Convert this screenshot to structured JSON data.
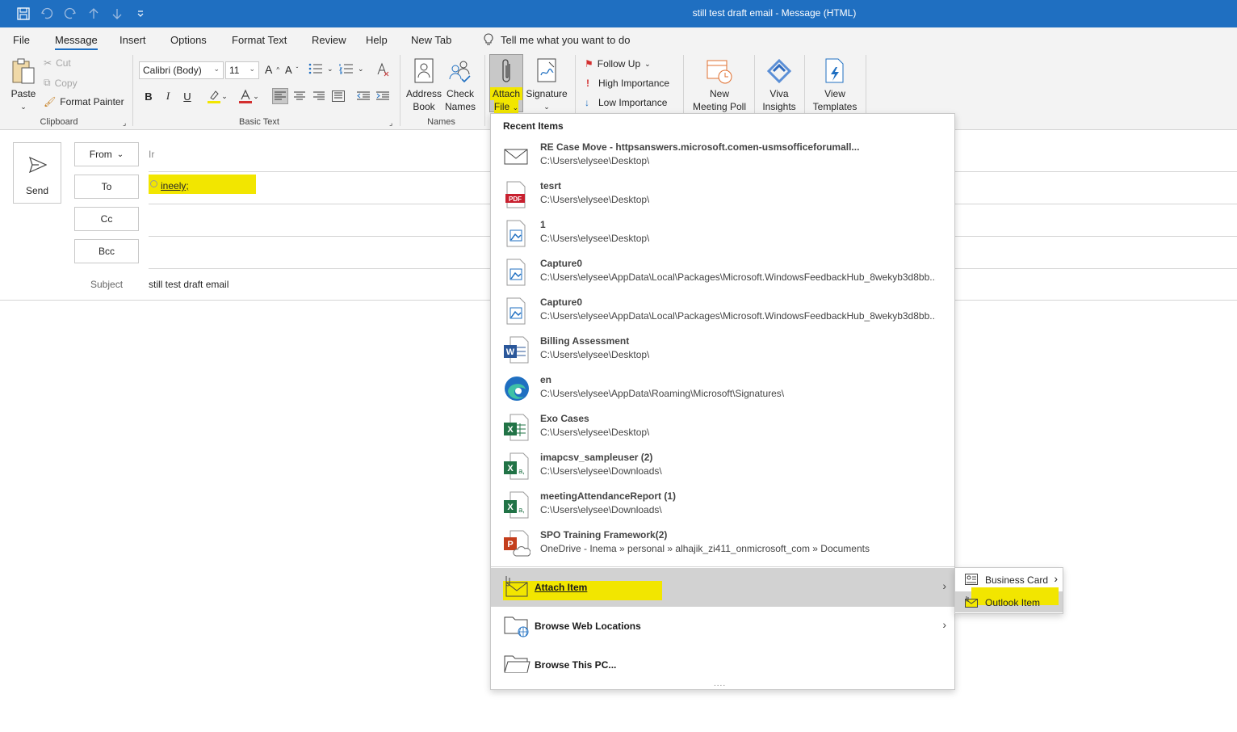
{
  "window": {
    "title": "still test draft email  -  Message (HTML)"
  },
  "quick_access": [
    "save-icon",
    "undo-icon",
    "redo-icon",
    "up-arrow-icon",
    "down-arrow-icon",
    "customize-icon"
  ],
  "tabs": [
    "File",
    "Message",
    "Insert",
    "Options",
    "Format Text",
    "Review",
    "Help",
    "New Tab"
  ],
  "active_tab": "Message",
  "tell_me": "Tell me what you want to do",
  "ribbon": {
    "clipboard": {
      "paste": "Paste",
      "cut": "Cut",
      "copy": "Copy",
      "format_painter": "Format Painter",
      "label": "Clipboard"
    },
    "basic_text": {
      "font": "Calibri (Body)",
      "size": "11",
      "label": "Basic Text",
      "bold": "B",
      "italic": "I",
      "underline": "U",
      "grow": "A",
      "shrink": "A"
    },
    "names": {
      "address_book": [
        "Address",
        "Book"
      ],
      "check_names": [
        "Check",
        "Names"
      ],
      "label": "Names"
    },
    "include": {
      "attach_file": [
        "Attach",
        "File"
      ],
      "signature": "Signature"
    },
    "tags": {
      "follow_up": "Follow Up",
      "high_importance": "High Importance",
      "low_importance": "Low Importance"
    },
    "meeting": [
      "New",
      "Meeting Poll"
    ],
    "viva": [
      "Viva",
      "Insights"
    ],
    "templates": [
      "View",
      "Templates"
    ]
  },
  "compose": {
    "send": "Send",
    "from": "From",
    "from_value": "Ir",
    "to": "To",
    "to_value": "ineely;",
    "cc": "Cc",
    "bcc": "Bcc",
    "subject_label": "Subject",
    "subject_value": "still test draft email"
  },
  "menu": {
    "heading": "Recent Items",
    "items": [
      {
        "icon": "mail-icon",
        "name": "RE Case Move - httpsanswers.microsoft.comen-usmsofficeforumall...",
        "path": "C:\\Users\\elysee\\Desktop\\"
      },
      {
        "icon": "pdf-icon",
        "name": "tesrt",
        "path": "C:\\Users\\elysee\\Desktop\\"
      },
      {
        "icon": "image-file-icon",
        "name": "1",
        "path": "C:\\Users\\elysee\\Desktop\\"
      },
      {
        "icon": "image-file-icon",
        "name": "Capture0",
        "path": "C:\\Users\\elysee\\AppData\\Local\\Packages\\Microsoft.WindowsFeedbackHub_8wekyb3d8bb..."
      },
      {
        "icon": "image-file-icon",
        "name": "Capture0",
        "path": "C:\\Users\\elysee\\AppData\\Local\\Packages\\Microsoft.WindowsFeedbackHub_8wekyb3d8bb..."
      },
      {
        "icon": "word-icon",
        "name": "Billing Assessment",
        "path": "C:\\Users\\elysee\\Desktop\\"
      },
      {
        "icon": "edge-icon",
        "name": "en",
        "path": "C:\\Users\\elysee\\AppData\\Roaming\\Microsoft\\Signatures\\"
      },
      {
        "icon": "excel-icon",
        "name": "Exo Cases",
        "path": "C:\\Users\\elysee\\Desktop\\"
      },
      {
        "icon": "excel-csv-icon",
        "name": "imapcsv_sampleuser (2)",
        "path": "C:\\Users\\elysee\\Downloads\\"
      },
      {
        "icon": "excel-csv-icon",
        "name": "meetingAttendanceReport (1)",
        "path": "C:\\Users\\elysee\\Downloads\\"
      },
      {
        "icon": "powerpoint-cloud-icon",
        "name": "SPO Training Framework(2)",
        "path": "OneDrive - Inema » personal » alhajik_zi411_onmicrosoft_com » Documents"
      }
    ],
    "attach_item": "Attach Item",
    "browse_web": "Browse Web Locations",
    "browse_pc": "Browse This PC..."
  },
  "submenu": {
    "business_card": "Business Card",
    "outlook_item": "Outlook Item"
  },
  "colors": {
    "titlebar": "#1f6fc1",
    "highlight": "#f2e600",
    "hover": "#d2d2d2"
  }
}
